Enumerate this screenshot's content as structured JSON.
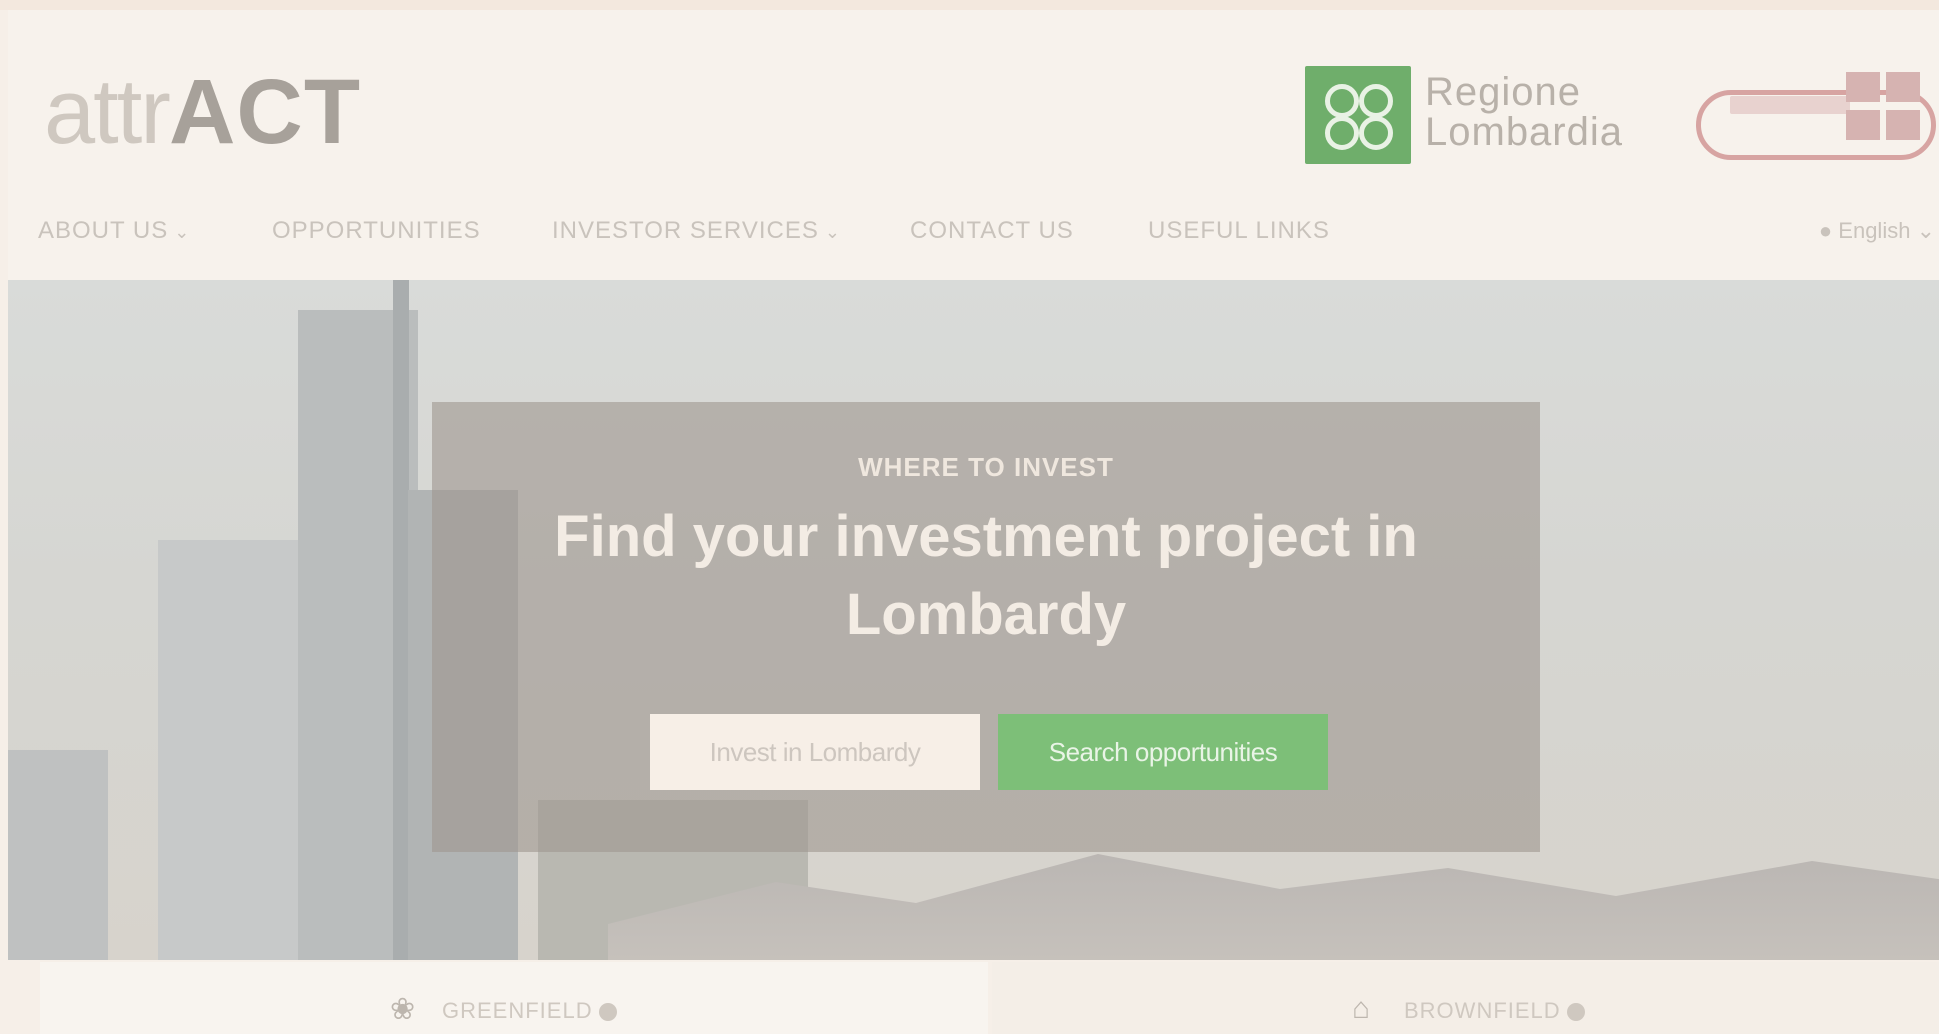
{
  "header": {
    "logo_light": "attr",
    "logo_bold": "ACT",
    "partner_regione": "Regione\nLombardia"
  },
  "nav": {
    "items": [
      {
        "label": "ABOUT US",
        "dropdown": true
      },
      {
        "label": "OPPORTUNITIES",
        "dropdown": false
      },
      {
        "label": "INVESTOR SERVICES",
        "dropdown": true
      },
      {
        "label": "CONTACT US",
        "dropdown": false
      },
      {
        "label": "USEFUL LINKS",
        "dropdown": false
      }
    ],
    "language": "English"
  },
  "hero": {
    "eyebrow": "WHERE TO INVEST",
    "title": "Find your investment project in Lombardy",
    "primary_button": "Invest in Lombardy",
    "secondary_button": "Search opportunities"
  },
  "cards": [
    {
      "label": "GREENFIELD",
      "icon": "leaf-icon"
    },
    {
      "label": "BROWNFIELD",
      "icon": "building-icon"
    }
  ],
  "colors": {
    "accent_green": "#7dbf78",
    "background": "#f6efe8"
  }
}
